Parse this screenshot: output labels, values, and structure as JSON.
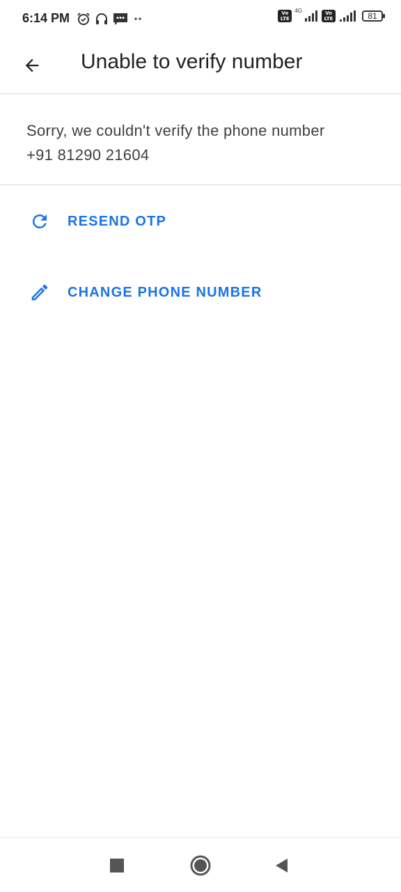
{
  "status_bar": {
    "time": "6:14 PM",
    "network_type": "4G",
    "volte_label": "Vo LTE",
    "battery_level": "81"
  },
  "app_bar": {
    "title": "Unable to verify number"
  },
  "message": {
    "line1": "Sorry, we couldn't verify the phone number",
    "line2": "+91 81290 21604"
  },
  "actions": [
    {
      "label": "RESEND OTP",
      "icon": "refresh-icon"
    },
    {
      "label": "CHANGE PHONE NUMBER",
      "icon": "pencil-icon"
    }
  ],
  "colors": {
    "accent": "#1a73e8",
    "text_primary": "#202124",
    "text_secondary": "#3c4043"
  }
}
